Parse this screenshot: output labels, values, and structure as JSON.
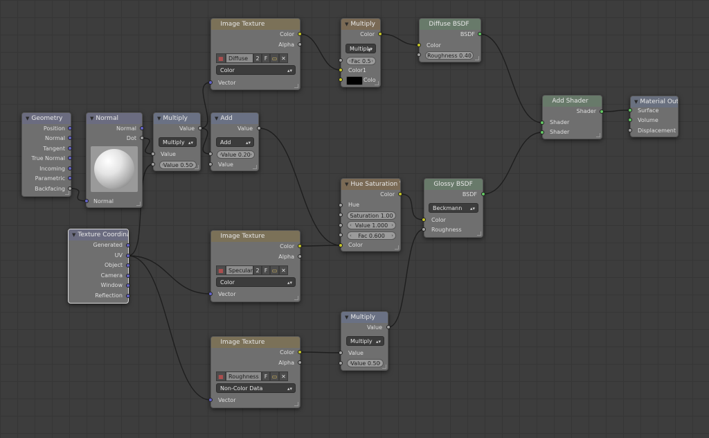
{
  "nodes": {
    "geometry": {
      "title": "Geometry",
      "outputs": [
        "Position",
        "Normal",
        "Tangent",
        "True Normal",
        "Incoming",
        "Parametric",
        "Backfacing"
      ]
    },
    "normal": {
      "title": "Normal",
      "out_normal": "Normal",
      "out_dot": "Dot",
      "in_normal": "Normal"
    },
    "multiply1": {
      "title": "Multiply",
      "out": "Value",
      "mode": "Multiply",
      "in_value": "Value",
      "field": "Value 0.50"
    },
    "add": {
      "title": "Add",
      "out": "Value",
      "mode": "Add",
      "field": "Value 0.20",
      "in_value": "Value"
    },
    "texcoord": {
      "title": "Texture Coordinate",
      "outputs": [
        "Generated",
        "UV",
        "Object",
        "Camera",
        "Window",
        "Reflection"
      ]
    },
    "img_diffuse": {
      "title": "Image Texture",
      "out_color": "Color",
      "out_alpha": "Alpha",
      "image_name": "Diffuse",
      "users": "2",
      "fake": "F",
      "colorspace": "Color",
      "in_vector": "Vector"
    },
    "img_specular": {
      "title": "Image Texture",
      "out_color": "Color",
      "out_alpha": "Alpha",
      "image_name": "Specular",
      "users": "2",
      "fake": "F",
      "colorspace": "Color",
      "in_vector": "Vector"
    },
    "img_rough": {
      "title": "Image Texture",
      "out_color": "Color",
      "out_alpha": "Alpha",
      "image_name": "Roughness",
      "fake": "F",
      "colorspace": "Non-Color Data",
      "in_vector": "Vector"
    },
    "mix_multiply": {
      "title": "Multiply",
      "out": "Color",
      "mode": "Multiply",
      "fac": "Fac 0.5",
      "in_color1": "Color1",
      "in_color2": "Colo",
      "swatch_color": "#000000"
    },
    "diffuse": {
      "title": "Diffuse BSDF",
      "out": "BSDF",
      "in_color": "Color",
      "roughness": "Roughness 0.40"
    },
    "hsv": {
      "title": "Hue Saturation Valu",
      "out": "Color",
      "in_hue": "Hue",
      "saturation": "Saturation 1.00",
      "value": "Value 1.000",
      "fac": "Fac 0.600",
      "in_color": "Color"
    },
    "glossy": {
      "title": "Glossy BSDF",
      "out": "BSDF",
      "distribution": "Beckmann",
      "in_color": "Color",
      "in_rough": "Roughness"
    },
    "add_shader": {
      "title": "Add Shader",
      "out": "Shader",
      "in1": "Shader",
      "in2": "Shader"
    },
    "output": {
      "title": "Material Outpu",
      "in_surface": "Surface",
      "in_volume": "Volume",
      "in_displacement": "Displacement"
    },
    "multiply2": {
      "title": "Multiply",
      "out": "Value",
      "mode": "Multiply",
      "in_value": "Value",
      "field": "Value 0.50"
    }
  },
  "colors": {
    "socket_color": "#c7c729",
    "socket_float": "#a1a1a1",
    "socket_vector": "#6363c7",
    "socket_shader": "#63c763",
    "link": "#1e1e1e",
    "node_body": "#6f6f6f",
    "grid_bg": "#3d3d3d"
  }
}
